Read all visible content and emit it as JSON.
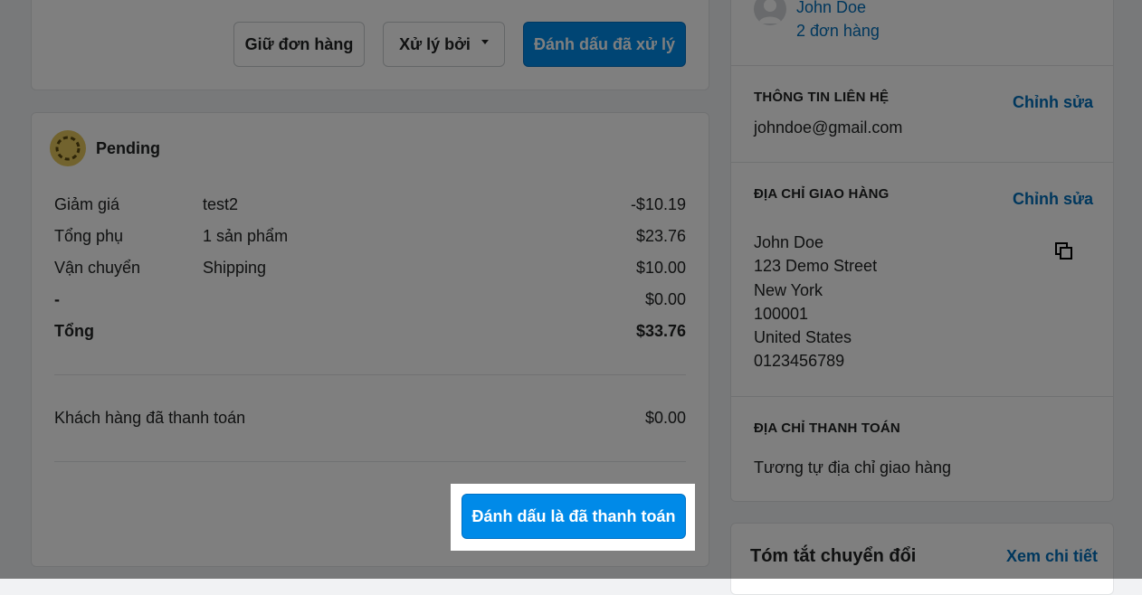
{
  "fulfill_card": {
    "hold_label": "Giữ đơn hàng",
    "process_by_label": "Xử lý bởi",
    "mark_fulfilled_label": "Đánh dấu đã xử lý"
  },
  "payment_card": {
    "status": "Pending",
    "rows": [
      {
        "label": "Giảm giá",
        "detail": "test2",
        "amount": "-$10.19"
      },
      {
        "label": "Tổng phụ",
        "detail": "1 sản phẩm",
        "amount": "$23.76"
      },
      {
        "label": "Vận chuyển",
        "detail": "Shipping",
        "amount": "$10.00"
      },
      {
        "label": "-",
        "detail": "",
        "amount": "$0.00"
      }
    ],
    "total": {
      "label": "Tổng",
      "amount": "$33.76"
    },
    "paid": {
      "label": "Khách hàng đã thanh toán",
      "amount": "$0.00"
    },
    "mark_paid_label": "Đánh dấu là đã thanh toán"
  },
  "customer": {
    "name": "John Doe",
    "orders": "2 đơn hàng"
  },
  "contact": {
    "title": "THÔNG TIN LIÊN HỆ",
    "edit_label": "Chỉnh sửa",
    "email": "johndoe@gmail.com"
  },
  "shipping": {
    "title": "ĐỊA CHỈ GIAO HÀNG",
    "edit_label": "Chỉnh sửa",
    "lines": [
      "John Doe",
      "123 Demo Street",
      "New York",
      "100001",
      "United States",
      "0123456789"
    ]
  },
  "billing": {
    "title": "ĐỊA CHỈ THANH TOÁN",
    "text": "Tương tự địa chỉ giao hàng"
  },
  "conversion": {
    "title": "Tóm tắt chuyển đổi",
    "link": "Xem chi tiết"
  },
  "colors": {
    "primary": "#008ae8",
    "link": "#006fbb",
    "pending": "#e4c65c"
  }
}
